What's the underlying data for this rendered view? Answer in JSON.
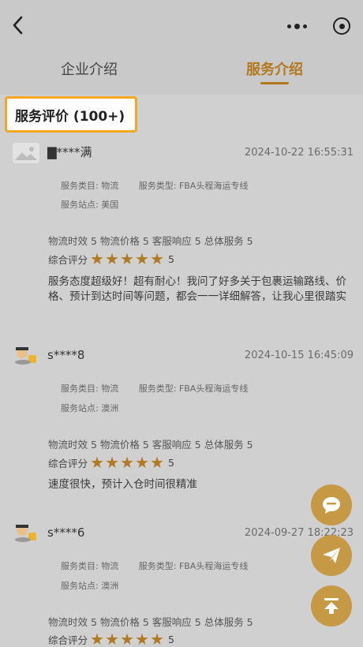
{
  "tabs": {
    "company": "企业介绍",
    "service": "服务介绍"
  },
  "section": {
    "title": "服务评价 (100+)"
  },
  "labels": {
    "category": "服务类目:",
    "type": "服务类型:",
    "site": "服务站点:",
    "overall": "综合评分"
  },
  "reviews": [
    {
      "user": "▇****满",
      "date": "2024-10-22 16:55:31",
      "category": "物流",
      "type": "FBA头程海运专线",
      "site": "美国",
      "scores": "物流时效 5  物流价格 5  客服响应 5  总体服务 5",
      "overall_score": "5",
      "rating": 5,
      "text": "服务态度超级好！超有耐心！我问了好多关于包裹运输路线、价格、预计到达时间等问题，都会一一详细解答，让我心里很踏实"
    },
    {
      "user": "s****8",
      "date": "2024-10-15 16:45:09",
      "category": "物流",
      "type": "FBA头程海运专线",
      "site": "澳洲",
      "scores": "物流时效 5  物流价格 5  客服响应 5  总体服务 5",
      "overall_score": "5",
      "rating": 5,
      "text": "速度很快，预计入仓时间很精准"
    },
    {
      "user": "s****6",
      "date": "2024-09-27 18:22:23",
      "category": "物流",
      "type": "FBA头程海运专线",
      "site": "澳洲",
      "scores": "物流时效 5  物流价格 5  客服响应 5  总体服务 5",
      "overall_score": "5",
      "rating": 5,
      "text": ""
    }
  ],
  "icons": {
    "back": "chevron-left-icon",
    "more": "more-dots-icon",
    "close": "target-icon",
    "chat": "chat-bubble-icon",
    "send": "paper-plane-icon",
    "top": "back-to-top-icon"
  },
  "colors": {
    "accent": "#b4781c",
    "highlight": "#f5a623",
    "fab": "#c69a45"
  }
}
